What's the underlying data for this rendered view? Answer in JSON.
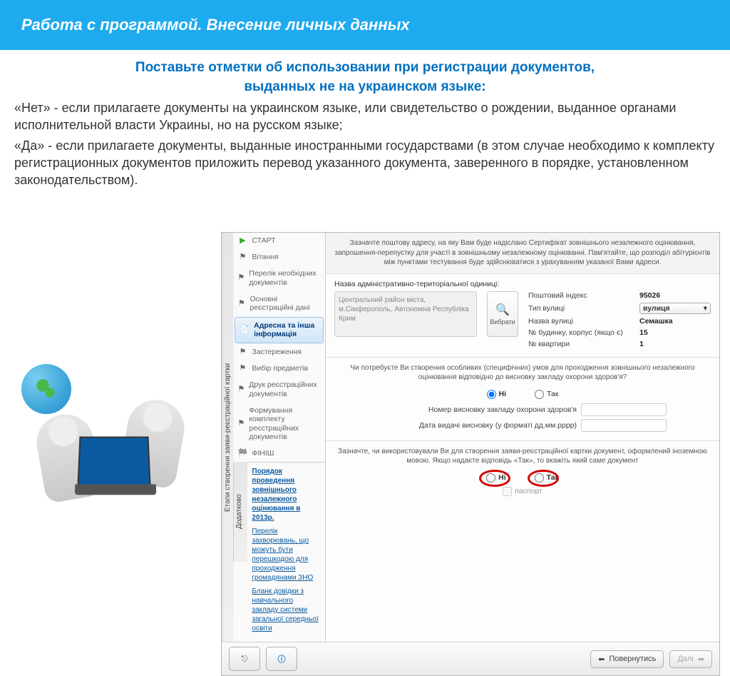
{
  "header": "Работа с программой. Внесение личных данных",
  "title_l1": "Поставьте отметки об использовании при регистрации документов,",
  "title_l2": "выданных не на украинском языке:",
  "para1": "«Нет» - если прилагаете документы на украинском языке, или свидетельство о рождении, выданное органами исполнительной власти Украины, но на русском языке;",
  "para2": "«Да» - если прилагаете документы, выданные иностранными государствами (в этом случае необходимо к комплекту регистрационных документов приложить перевод указанного документа, заверенного в порядке, установленном законодательством).",
  "app": {
    "vtab_steps": "Етапи створення заяви-реєстраційної картки",
    "vtab_addl": "Додатково",
    "nav": {
      "start": "СТАРТ",
      "greeting": "Вітання",
      "docs": "Перелік необхідних документів",
      "regdata": "Основні реєстраційні дані",
      "address": "Адресна та інша інформація",
      "warn": "Застереження",
      "subj": "Вибір предметів",
      "print": "Друк реєстраційних документів",
      "bundle": "Формування комплекту реєстраційних документів",
      "finish": "ФІНІШ"
    },
    "links": {
      "order": "Порядок проведення зовнішнього незалежного оцінювання в 2013р.",
      "diseases": "Перелік захворювань, що можуть бути перешкодою для проходження громадянами ЗНО",
      "blank": "Бланк довідки з навчального закладу системи загальної середньої освіти"
    },
    "panel": {
      "instr": "Зазначте поштову адресу, на яку Вам буде надіслано Сертифікат зовнішнього незалежного оцінювання, запрошення-перепустку для участі в зовнішньому незалежному оцінюванні. Пам'ятайте, що розподіл абітурієнтів між пунктами тестування буде здійснюватися з урахуванням указаної Вами адреси.",
      "region_label": "Назва адміністративно-територіальної одиниці:",
      "region_value": "Центральний район міста, м.Сімферополь, Автономна Республіка Крим",
      "choose": "Вибрати",
      "postal_label": "Поштовий індекс",
      "postal_value": "95026",
      "street_type_label": "Тип вулиці",
      "street_type_value": "вулиця",
      "street_name_label": "Назва вулиці",
      "street_name_value": "Семашка",
      "house_label": "№ будинку, корпус (якщо є)",
      "house_value": "15",
      "apt_label": "№ квартири",
      "apt_value": "1",
      "special_q": "Чи потребуєте Ви створення особливих (специфічних) умов для проходження зовнішнього незалежного оцінювання відповідно до висновку закладу охорони здоров'я?",
      "opt_no": "Ні",
      "opt_yes": "Так",
      "concl_num": "Номер висновку закладу охорони здоров'я",
      "concl_date": "Дата видачі висновку (у форматі дд.мм.рррр)",
      "foreign_q": "Зазначте, чи використовували Ви для створення заяви-реєстраційної картки документ, оформлений іноземною мовою. Якщо надаєте відповідь «Так», то вкажіть який саме документ",
      "passport": "паспорт"
    },
    "bottom": {
      "back": "Повернутись",
      "next": "Далі"
    }
  }
}
